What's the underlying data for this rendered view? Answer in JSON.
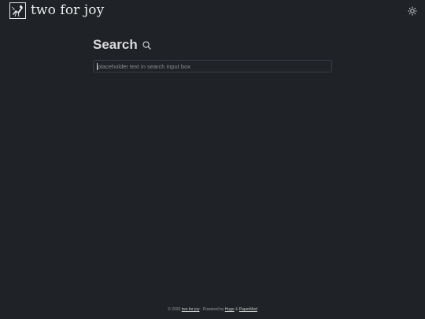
{
  "header": {
    "site_title": "two for joy",
    "logo_icon": "magpie-logo-icon",
    "theme_toggle_icon": "sun-icon"
  },
  "main": {
    "heading": "Search",
    "heading_icon": "search-icon",
    "search_placeholder": "placeholder text in search input box",
    "search_value": ""
  },
  "footer": {
    "copyright": "© 2026",
    "site_link": "two for joy",
    "separator": " · Powered by ",
    "hugo_link": "Hugo",
    "ampersand": " & ",
    "papermod_link": "PaperMod"
  },
  "colors": {
    "background": "#1f2226",
    "text": "#dadadb",
    "input_border": "#3a3e44",
    "placeholder": "#8a8c90"
  }
}
